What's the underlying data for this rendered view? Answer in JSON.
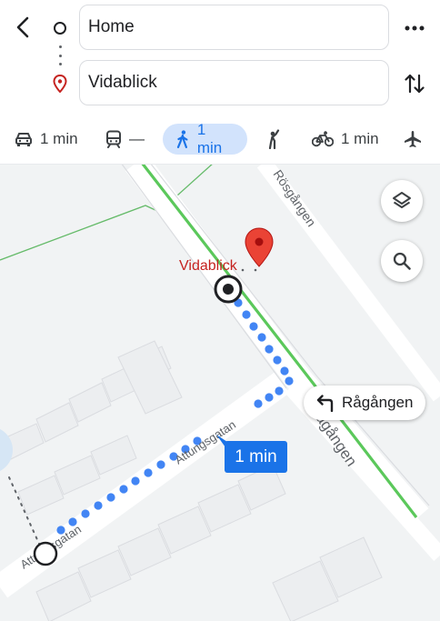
{
  "search": {
    "origin_value": "Home",
    "destination_value": "Vidablick"
  },
  "modes": {
    "drive": {
      "icon": "car-icon",
      "time": "1 min"
    },
    "transit": {
      "icon": "transit-icon",
      "time": "—"
    },
    "walk": {
      "icon": "walk-icon",
      "time": "1 min",
      "selected": true
    },
    "ride": {
      "icon": "ride-hail-icon"
    },
    "bike": {
      "icon": "bike-icon",
      "time": "1 min"
    },
    "flight": {
      "icon": "airplane-icon"
    }
  },
  "map": {
    "destination_label": "Vidablick",
    "streets": {
      "rosgangen": "Rösgången",
      "ragangen": "Rågången",
      "attungsgatan_1": "Attungsgatan",
      "attungsgatan_2": "Attungsgatan"
    },
    "turn_instruction": "Rågången",
    "eta": "1 min"
  },
  "colors": {
    "accent": "#1a73e8",
    "selected_chip": "#d2e3fc",
    "pin": "#ea4335",
    "dest_text": "#c5221f",
    "green_path": "#5bc85b"
  }
}
